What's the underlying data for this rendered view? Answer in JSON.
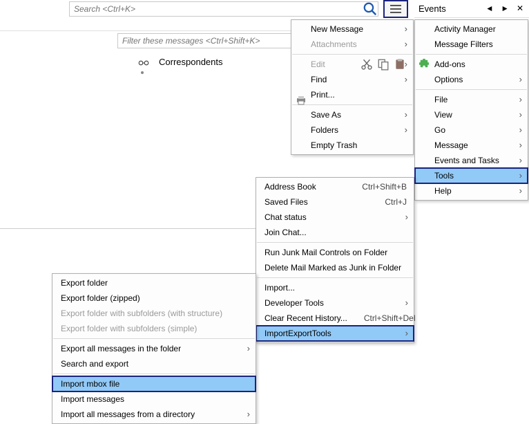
{
  "search": {
    "placeholder": "Search <Ctrl+K>"
  },
  "filter": {
    "placeholder": "Filter these messages <Ctrl+Shift+K>"
  },
  "events_title": "Events",
  "correspondents_label": "Correspondents",
  "hamburger_menu": {
    "new_message": "New Message",
    "attachments": "Attachments",
    "edit": "Edit",
    "find": "Find",
    "print": "Print...",
    "save_as": "Save As",
    "folders": "Folders",
    "empty_trash": "Empty Trash"
  },
  "right_menu": {
    "activity_manager": "Activity Manager",
    "message_filters": "Message Filters",
    "addons": "Add-ons",
    "options": "Options",
    "file": "File",
    "view": "View",
    "go": "Go",
    "message": "Message",
    "events_tasks": "Events and Tasks",
    "tools": "Tools",
    "help": "Help"
  },
  "tools_menu": {
    "address_book": {
      "label": "Address Book",
      "shortcut": "Ctrl+Shift+B"
    },
    "saved_files": {
      "label": "Saved Files",
      "shortcut": "Ctrl+J"
    },
    "chat_status": "Chat status",
    "join_chat": "Join Chat...",
    "run_junk": "Run Junk Mail Controls on Folder",
    "delete_junk": "Delete Mail Marked as Junk in Folder",
    "import": "Import...",
    "dev_tools": "Developer Tools",
    "clear_history": {
      "label": "Clear Recent History...",
      "shortcut": "Ctrl+Shift+Del"
    },
    "iet": "ImportExportTools"
  },
  "iet_menu": {
    "export_folder": "Export folder",
    "export_folder_zipped": "Export folder (zipped)",
    "export_sub_structure": "Export folder with subfolders (with structure)",
    "export_sub_simple": "Export folder with subfolders (simple)",
    "export_all_messages": "Export all messages in the folder",
    "search_export": "Search and export",
    "import_mbox": "Import mbox file",
    "import_messages": "Import messages",
    "import_all_dir": "Import all messages from a directory"
  }
}
